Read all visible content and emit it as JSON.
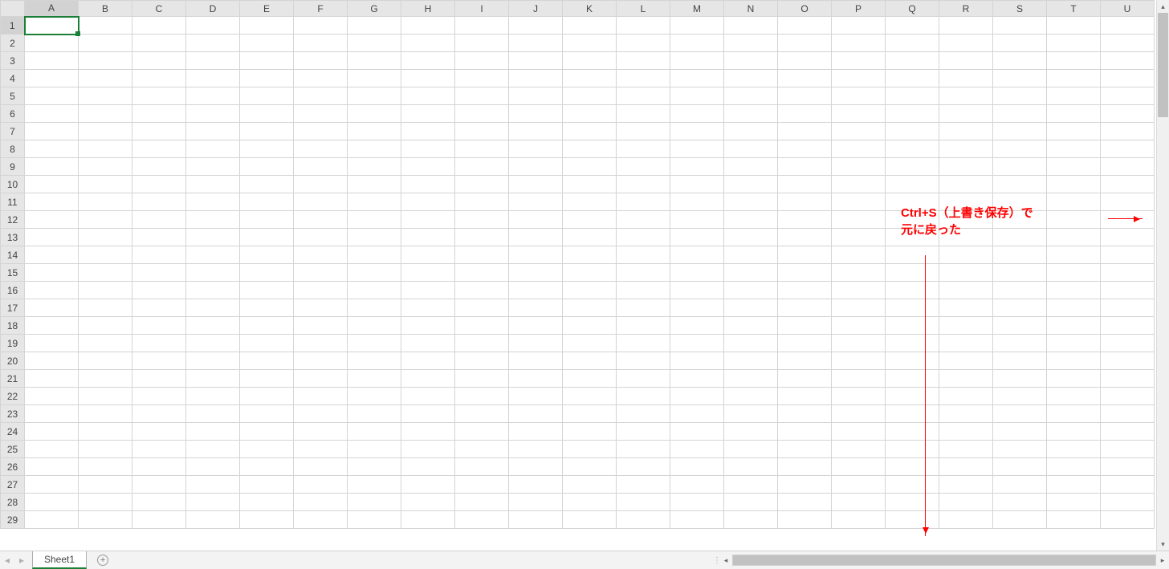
{
  "columns": [
    "A",
    "B",
    "C",
    "D",
    "E",
    "F",
    "G",
    "H",
    "I",
    "J",
    "K",
    "L",
    "M",
    "N",
    "O",
    "P",
    "Q",
    "R",
    "S",
    "T",
    "U"
  ],
  "rows": [
    "1",
    "2",
    "3",
    "4",
    "5",
    "6",
    "7",
    "8",
    "9",
    "10",
    "11",
    "12",
    "13",
    "14",
    "15",
    "16",
    "17",
    "18",
    "19",
    "20",
    "21",
    "22",
    "23",
    "24",
    "25",
    "26",
    "27",
    "28",
    "29"
  ],
  "selected_cell": "A1",
  "annotation": {
    "line1": "Ctrl+S（上書き保存）で",
    "line2": "元に戻った"
  },
  "tabs": {
    "active": "Sheet1"
  }
}
